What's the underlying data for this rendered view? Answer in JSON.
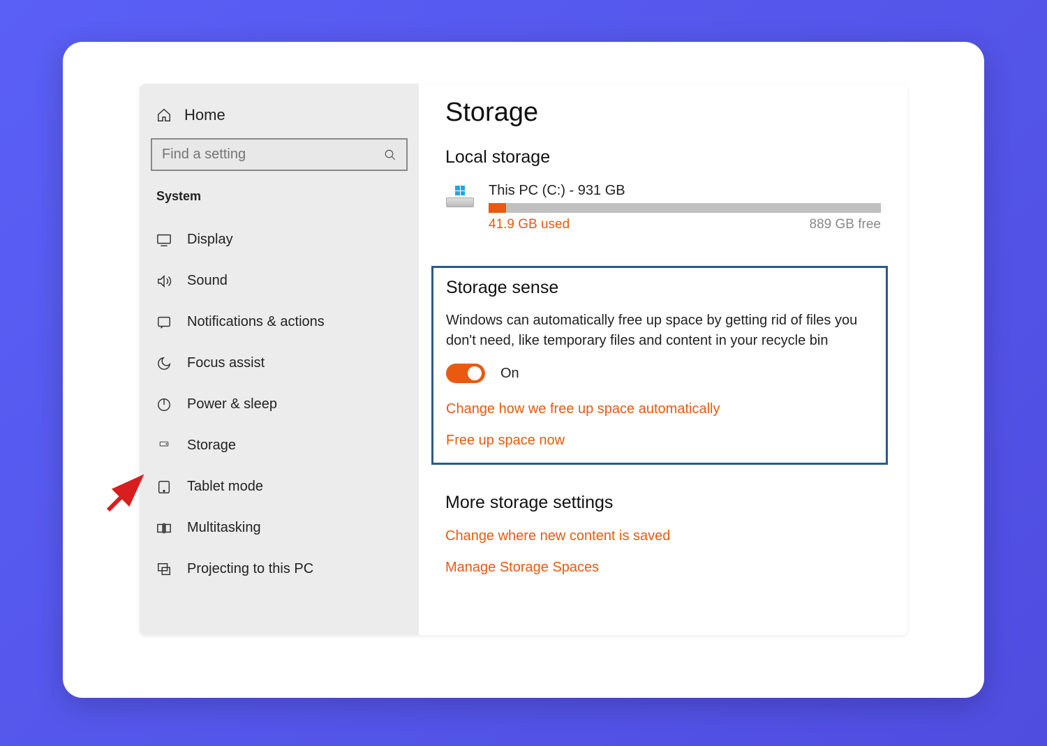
{
  "sidebar": {
    "home_label": "Home",
    "search_placeholder": "Find a setting",
    "category": "System",
    "items": [
      {
        "id": "display",
        "label": "Display"
      },
      {
        "id": "sound",
        "label": "Sound"
      },
      {
        "id": "notifications",
        "label": "Notifications & actions"
      },
      {
        "id": "focus-assist",
        "label": "Focus assist"
      },
      {
        "id": "power-sleep",
        "label": "Power & sleep"
      },
      {
        "id": "storage",
        "label": "Storage"
      },
      {
        "id": "tablet-mode",
        "label": "Tablet mode"
      },
      {
        "id": "multitasking",
        "label": "Multitasking"
      },
      {
        "id": "projecting",
        "label": "Projecting to this PC"
      }
    ]
  },
  "main": {
    "title": "Storage",
    "local_storage_title": "Local storage",
    "drive": {
      "name": "This PC (C:) - 931 GB",
      "used_label": "41.9 GB used",
      "free_label": "889 GB free",
      "used_percent": 4.5
    },
    "storage_sense": {
      "title": "Storage sense",
      "description": "Windows can automatically free up space by getting rid of files you don't need, like temporary files and content in your recycle bin",
      "toggle_state": "On",
      "link_change": "Change how we free up space automatically",
      "link_free_now": "Free up space now"
    },
    "more": {
      "title": "More storage settings",
      "link_change_where": "Change where new content is saved",
      "link_manage": "Manage Storage Spaces"
    }
  }
}
